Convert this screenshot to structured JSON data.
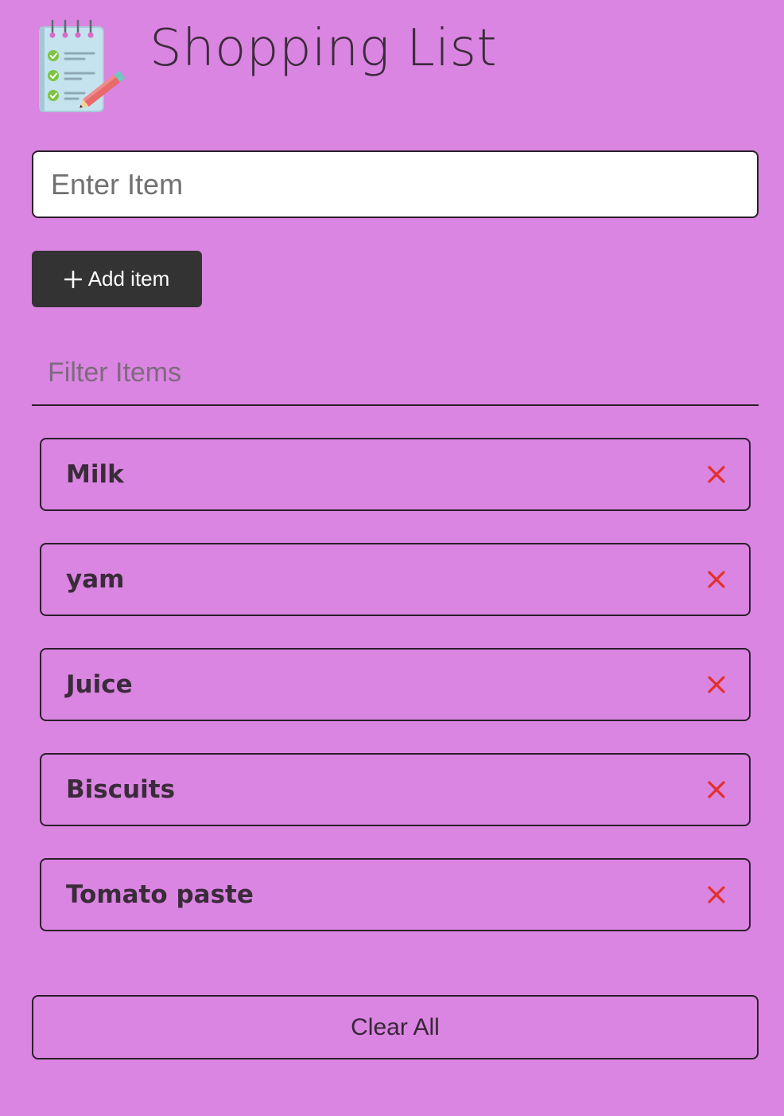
{
  "header": {
    "title": "Shopping List",
    "logo_icon": "notepad-checklist-icon"
  },
  "item_input": {
    "placeholder": "Enter Item",
    "value": ""
  },
  "add_button": {
    "label": "Add item",
    "icon": "plus-icon"
  },
  "filter": {
    "placeholder": "Filter Items",
    "value": ""
  },
  "items": [
    {
      "label": "Milk",
      "remove_icon": "close-icon"
    },
    {
      "label": "yam",
      "remove_icon": "close-icon"
    },
    {
      "label": "Juice",
      "remove_icon": "close-icon"
    },
    {
      "label": "Biscuits",
      "remove_icon": "close-icon"
    },
    {
      "label": "Tomato paste",
      "remove_icon": "close-icon"
    }
  ],
  "clear_button": {
    "label": "Clear All"
  },
  "colors": {
    "background": "#da85e1",
    "text": "#362736",
    "add_button_bg": "#333333",
    "remove_icon": "#e3302c",
    "border": "#2a1f2a"
  }
}
